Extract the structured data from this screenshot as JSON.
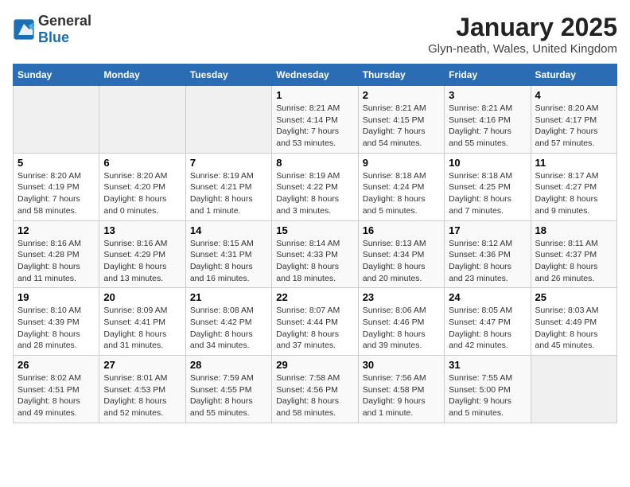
{
  "header": {
    "logo_general": "General",
    "logo_blue": "Blue",
    "title": "January 2025",
    "subtitle": "Glyn-neath, Wales, United Kingdom"
  },
  "days_of_week": [
    "Sunday",
    "Monday",
    "Tuesday",
    "Wednesday",
    "Thursday",
    "Friday",
    "Saturday"
  ],
  "weeks": [
    [
      {
        "day": "",
        "info": ""
      },
      {
        "day": "",
        "info": ""
      },
      {
        "day": "",
        "info": ""
      },
      {
        "day": "1",
        "info": "Sunrise: 8:21 AM\nSunset: 4:14 PM\nDaylight: 7 hours and 53 minutes."
      },
      {
        "day": "2",
        "info": "Sunrise: 8:21 AM\nSunset: 4:15 PM\nDaylight: 7 hours and 54 minutes."
      },
      {
        "day": "3",
        "info": "Sunrise: 8:21 AM\nSunset: 4:16 PM\nDaylight: 7 hours and 55 minutes."
      },
      {
        "day": "4",
        "info": "Sunrise: 8:20 AM\nSunset: 4:17 PM\nDaylight: 7 hours and 57 minutes."
      }
    ],
    [
      {
        "day": "5",
        "info": "Sunrise: 8:20 AM\nSunset: 4:19 PM\nDaylight: 7 hours and 58 minutes."
      },
      {
        "day": "6",
        "info": "Sunrise: 8:20 AM\nSunset: 4:20 PM\nDaylight: 8 hours and 0 minutes."
      },
      {
        "day": "7",
        "info": "Sunrise: 8:19 AM\nSunset: 4:21 PM\nDaylight: 8 hours and 1 minute."
      },
      {
        "day": "8",
        "info": "Sunrise: 8:19 AM\nSunset: 4:22 PM\nDaylight: 8 hours and 3 minutes."
      },
      {
        "day": "9",
        "info": "Sunrise: 8:18 AM\nSunset: 4:24 PM\nDaylight: 8 hours and 5 minutes."
      },
      {
        "day": "10",
        "info": "Sunrise: 8:18 AM\nSunset: 4:25 PM\nDaylight: 8 hours and 7 minutes."
      },
      {
        "day": "11",
        "info": "Sunrise: 8:17 AM\nSunset: 4:27 PM\nDaylight: 8 hours and 9 minutes."
      }
    ],
    [
      {
        "day": "12",
        "info": "Sunrise: 8:16 AM\nSunset: 4:28 PM\nDaylight: 8 hours and 11 minutes."
      },
      {
        "day": "13",
        "info": "Sunrise: 8:16 AM\nSunset: 4:29 PM\nDaylight: 8 hours and 13 minutes."
      },
      {
        "day": "14",
        "info": "Sunrise: 8:15 AM\nSunset: 4:31 PM\nDaylight: 8 hours and 16 minutes."
      },
      {
        "day": "15",
        "info": "Sunrise: 8:14 AM\nSunset: 4:33 PM\nDaylight: 8 hours and 18 minutes."
      },
      {
        "day": "16",
        "info": "Sunrise: 8:13 AM\nSunset: 4:34 PM\nDaylight: 8 hours and 20 minutes."
      },
      {
        "day": "17",
        "info": "Sunrise: 8:12 AM\nSunset: 4:36 PM\nDaylight: 8 hours and 23 minutes."
      },
      {
        "day": "18",
        "info": "Sunrise: 8:11 AM\nSunset: 4:37 PM\nDaylight: 8 hours and 26 minutes."
      }
    ],
    [
      {
        "day": "19",
        "info": "Sunrise: 8:10 AM\nSunset: 4:39 PM\nDaylight: 8 hours and 28 minutes."
      },
      {
        "day": "20",
        "info": "Sunrise: 8:09 AM\nSunset: 4:41 PM\nDaylight: 8 hours and 31 minutes."
      },
      {
        "day": "21",
        "info": "Sunrise: 8:08 AM\nSunset: 4:42 PM\nDaylight: 8 hours and 34 minutes."
      },
      {
        "day": "22",
        "info": "Sunrise: 8:07 AM\nSunset: 4:44 PM\nDaylight: 8 hours and 37 minutes."
      },
      {
        "day": "23",
        "info": "Sunrise: 8:06 AM\nSunset: 4:46 PM\nDaylight: 8 hours and 39 minutes."
      },
      {
        "day": "24",
        "info": "Sunrise: 8:05 AM\nSunset: 4:47 PM\nDaylight: 8 hours and 42 minutes."
      },
      {
        "day": "25",
        "info": "Sunrise: 8:03 AM\nSunset: 4:49 PM\nDaylight: 8 hours and 45 minutes."
      }
    ],
    [
      {
        "day": "26",
        "info": "Sunrise: 8:02 AM\nSunset: 4:51 PM\nDaylight: 8 hours and 49 minutes."
      },
      {
        "day": "27",
        "info": "Sunrise: 8:01 AM\nSunset: 4:53 PM\nDaylight: 8 hours and 52 minutes."
      },
      {
        "day": "28",
        "info": "Sunrise: 7:59 AM\nSunset: 4:55 PM\nDaylight: 8 hours and 55 minutes."
      },
      {
        "day": "29",
        "info": "Sunrise: 7:58 AM\nSunset: 4:56 PM\nDaylight: 8 hours and 58 minutes."
      },
      {
        "day": "30",
        "info": "Sunrise: 7:56 AM\nSunset: 4:58 PM\nDaylight: 9 hours and 1 minute."
      },
      {
        "day": "31",
        "info": "Sunrise: 7:55 AM\nSunset: 5:00 PM\nDaylight: 9 hours and 5 minutes."
      },
      {
        "day": "",
        "info": ""
      }
    ]
  ]
}
